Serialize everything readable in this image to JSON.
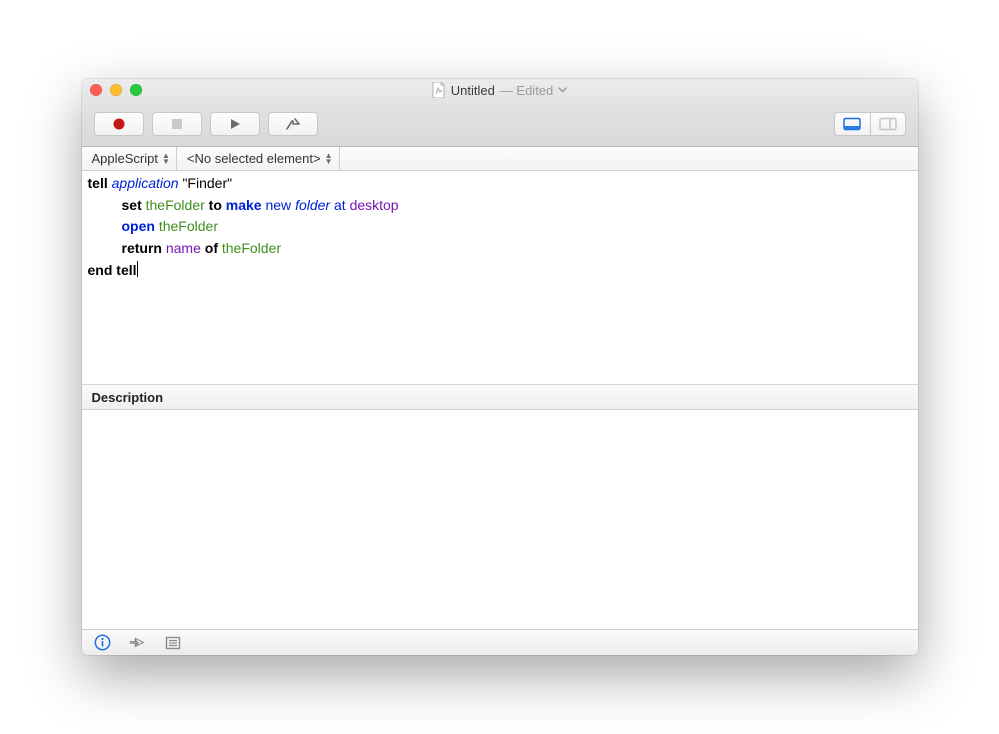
{
  "window": {
    "doc_name": "Untitled",
    "edited_label": "— Edited"
  },
  "navbar": {
    "language_label": "AppleScript",
    "accessory_label": "<No selected element>"
  },
  "code": {
    "l1": {
      "tell": "tell",
      "application": "application",
      "finder_str": "\"Finder\""
    },
    "l2": {
      "set": "set",
      "theFolder": "theFolder",
      "to": "to",
      "make": "make",
      "new": "new",
      "folder": "folder",
      "at": "at",
      "desktop": "desktop"
    },
    "l3": {
      "open": "open",
      "theFolder": "theFolder"
    },
    "l4": {
      "return": "return",
      "name": "name",
      "of": "of",
      "theFolder": "theFolder"
    },
    "l5": {
      "end_tell": "end tell"
    }
  },
  "description": {
    "header": "Description"
  }
}
